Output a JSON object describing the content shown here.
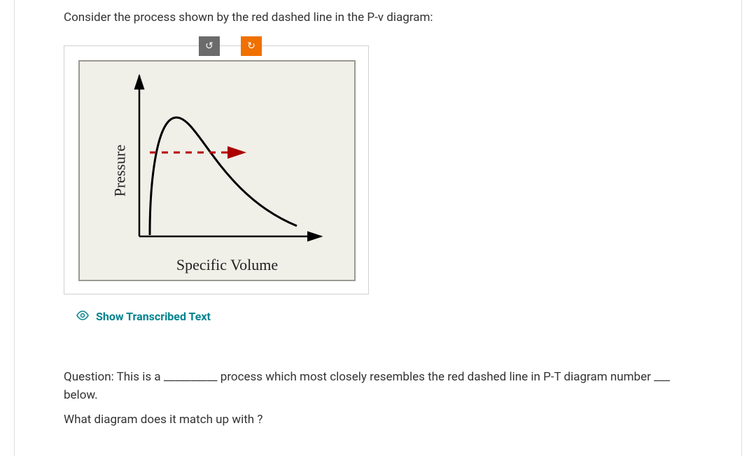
{
  "intro": "Consider the process shown by the red dashed line in the P-v diagram:",
  "chart_data": {
    "type": "line",
    "title": "",
    "xlabel": "Specific Volume",
    "ylabel": "Pressure",
    "series": [
      {
        "name": "saturation-dome",
        "style": "solid-black",
        "description": "Phase dome curve rising steeply, peaking, then descending and flattening to the right"
      },
      {
        "name": "process-line",
        "style": "dashed-red-arrow",
        "description": "Horizontal constant-pressure dashed line at a level below the dome peak, crossing the dome left-to-right with an arrowhead on the right"
      }
    ],
    "xlim": null,
    "ylim": null,
    "grid": false,
    "legend": false
  },
  "rotate": {
    "ccw_label": "↺",
    "cw_label": "↻"
  },
  "transcribed": {
    "label": "Show Transcribed Text"
  },
  "question": {
    "line1": "Question: This is a __________ process which most closely resembles the red dashed line in P-T diagram number ___ below.",
    "line2": "What diagram does it match up with ?"
  }
}
